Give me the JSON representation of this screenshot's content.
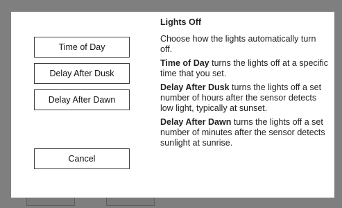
{
  "dialog": {
    "title": "Lights Off",
    "intro": "Choose how the lights automatically turn off.",
    "buttons": {
      "time_of_day": "Time of Day",
      "delay_after_dusk": "Delay After Dusk",
      "delay_after_dawn": "Delay After Dawn",
      "cancel": "Cancel"
    },
    "descriptions": {
      "time_of_day": {
        "term": "Time of Day",
        "text": " turns the lights off at a specific time that you set."
      },
      "delay_after_dusk": {
        "term": "Delay After Dusk",
        "text": " turns the lights off a set number of hours after the sensor detects low light, typically at sunset."
      },
      "delay_after_dawn": {
        "term": "Delay After Dawn",
        "text": " turns the lights off a set number of minutes after the sensor detects sunlight at sunrise."
      }
    }
  },
  "colors": {
    "overlay": "#7f7f7f",
    "dialog_bg": "#ffffff",
    "button_border": "#3c3c3c"
  }
}
